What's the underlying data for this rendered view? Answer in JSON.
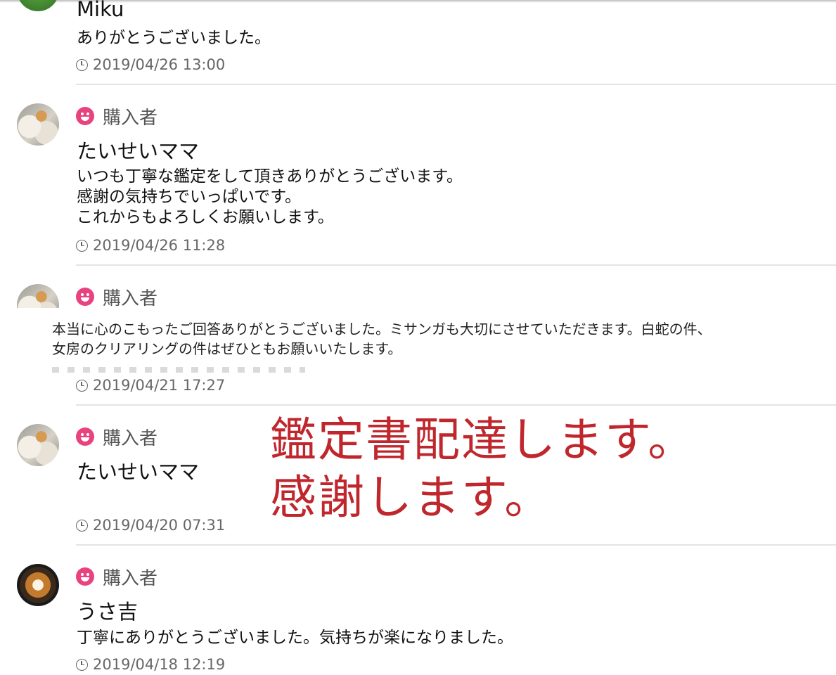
{
  "reviews": [
    {
      "user": "Miku",
      "message": "ありがとうございました。",
      "time": "2019/04/26 13:00"
    },
    {
      "role": "購入者",
      "user": "たいせいママ",
      "message": "いつも丁寧な鑑定をして頂きありがとうございます。\n感謝の気持ちでいっぱいです。\nこれからもよろしくお願いします。",
      "time": "2019/04/26 11:28"
    },
    {
      "role": "購入者",
      "message": "本当に心のこもったご回答ありがとうございました。ミサンガも大切にさせていただきます。白蛇の件、\n女房のクリアリングの件はぜひともお願いいたします。",
      "time": "2019/04/21 17:27"
    },
    {
      "role": "購入者",
      "user": "たいせいママ",
      "time": "2019/04/20 07:31"
    },
    {
      "role": "購入者",
      "user": "うさ吉",
      "message": "丁寧にありがとうございました。気持ちが楽になりました。",
      "time": "2019/04/18 12:19"
    }
  ],
  "overlay_note": {
    "line1": "鑑定書配達します。",
    "line2": "感謝します。"
  },
  "colors": {
    "role_icon": "#e8437f",
    "note_red": "#c0272d"
  }
}
